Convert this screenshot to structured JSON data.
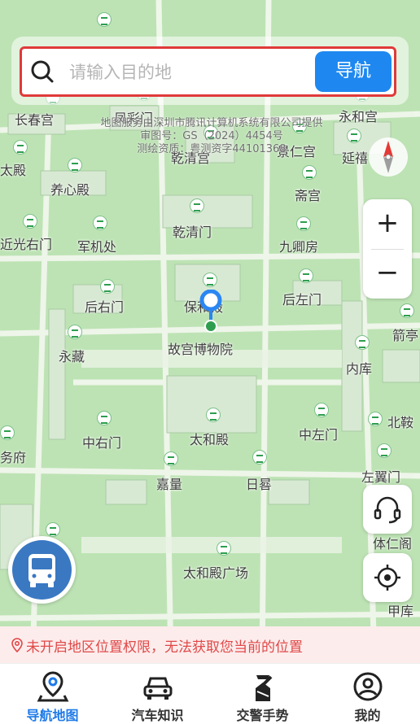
{
  "search": {
    "placeholder": "请输入目的地",
    "nav_button": "导航"
  },
  "copyright": {
    "line1": "地图服务由深圳市腾讯计算机系统有限公司提供",
    "line2": "审图号：GS（2024）4454号",
    "line3": "测绘资质：粤测资字44101368"
  },
  "map_labels": {
    "changchungong": "长春宫",
    "fengcaimen": "凤彩门",
    "yonghegong": "永和宫",
    "qianqinggong": "乾清宫",
    "jingrengong": "景仁宫",
    "yanqi": "延禧",
    "taidian": "太殿",
    "yangxindian": "养心殿",
    "zhaigong": "斋宫",
    "qianqingmen": "乾清门",
    "jinguangyoumen": "近光右门",
    "junjichu": "军机处",
    "jiuqingfang": "九卿房",
    "baohedian": "保和殿",
    "houyoumen": "后右门",
    "houzuomen": "后左门",
    "jian": "箭亭",
    "yongcang": "永藏",
    "gugongbowuyuan": "故宫博物院",
    "neiku": "内库",
    "taihedian": "太和殿",
    "beiku": "北鞍",
    "zhongyoumen": "中右门",
    "zhongzuomen": "中左门",
    "wufu": "务府",
    "jialiang": "嘉量",
    "rigui": "日晷",
    "zuoyimen": "左翼门",
    "tirenge": "体仁阁",
    "taihedianguangchang": "太和殿广场",
    "jiaku": "甲库"
  },
  "warning": {
    "text": "未开启地区位置权限，无法获取您当前的位置"
  },
  "tabs": [
    {
      "label": "导航地图",
      "icon": "map-pin-icon",
      "active": true
    },
    {
      "label": "汽车知识",
      "icon": "car-icon",
      "active": false
    },
    {
      "label": "交警手势",
      "icon": "traffic-police-icon",
      "active": false
    },
    {
      "label": "我的",
      "icon": "user-icon",
      "active": false
    }
  ],
  "colors": {
    "accent": "#1e88f0",
    "tab_active": "#1e7ae8",
    "warning_text": "#e04848",
    "warning_bg": "#fdecec",
    "search_border": "#e03a3a",
    "map_green": "#bde3b4"
  }
}
